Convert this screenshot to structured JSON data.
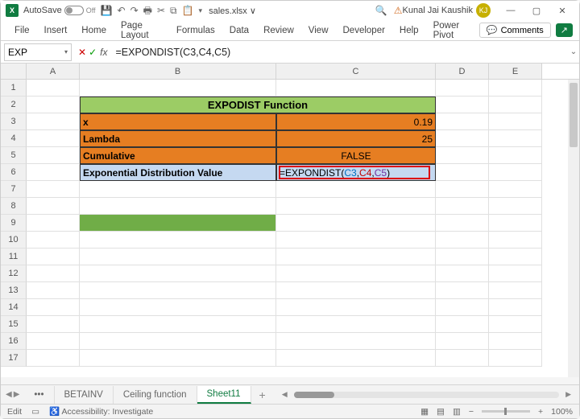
{
  "title_bar": {
    "app_icon": "X",
    "autosave_label": "AutoSave",
    "autosave_state": "Off",
    "filename": "sales.xlsx ∨",
    "user_name": "Kunal Jai Kaushik",
    "user_initials": "KJ"
  },
  "ribbon": {
    "tabs": [
      "File",
      "Insert",
      "Home",
      "Page Layout",
      "Formulas",
      "Data",
      "Review",
      "View",
      "Developer",
      "Help",
      "Power Pivot"
    ],
    "comments": "Comments"
  },
  "formula_bar": {
    "name_box": "EXP",
    "formula": "=EXPONDIST(C3,C4,C5)"
  },
  "columns": [
    "A",
    "B",
    "C",
    "D",
    "E"
  ],
  "rows": [
    "1",
    "2",
    "3",
    "4",
    "5",
    "6",
    "7",
    "8",
    "9",
    "10",
    "11",
    "12",
    "13",
    "14",
    "15",
    "16",
    "17"
  ],
  "sheet": {
    "title": "EXPODIST Function",
    "labels": {
      "x": "x",
      "lambda": "Lambda",
      "cumulative": "Cumulative",
      "result": "Exponential Distribution Value"
    },
    "values": {
      "x": "0.19",
      "lambda": "25",
      "cumulative": "FALSE"
    },
    "formula": {
      "prefix": "=EXPONDIST(",
      "r1": "C3",
      "c1": ",",
      "r2": "C4",
      "c2": ",",
      "r3": "C5",
      "suffix": ")"
    }
  },
  "tabs": {
    "ellipsis": "•••",
    "t1": "BETAINV",
    "t2": "Ceiling function",
    "t3": "Sheet11"
  },
  "status": {
    "mode": "Edit",
    "access": "Accessibility: Investigate",
    "zoom": "100%"
  }
}
